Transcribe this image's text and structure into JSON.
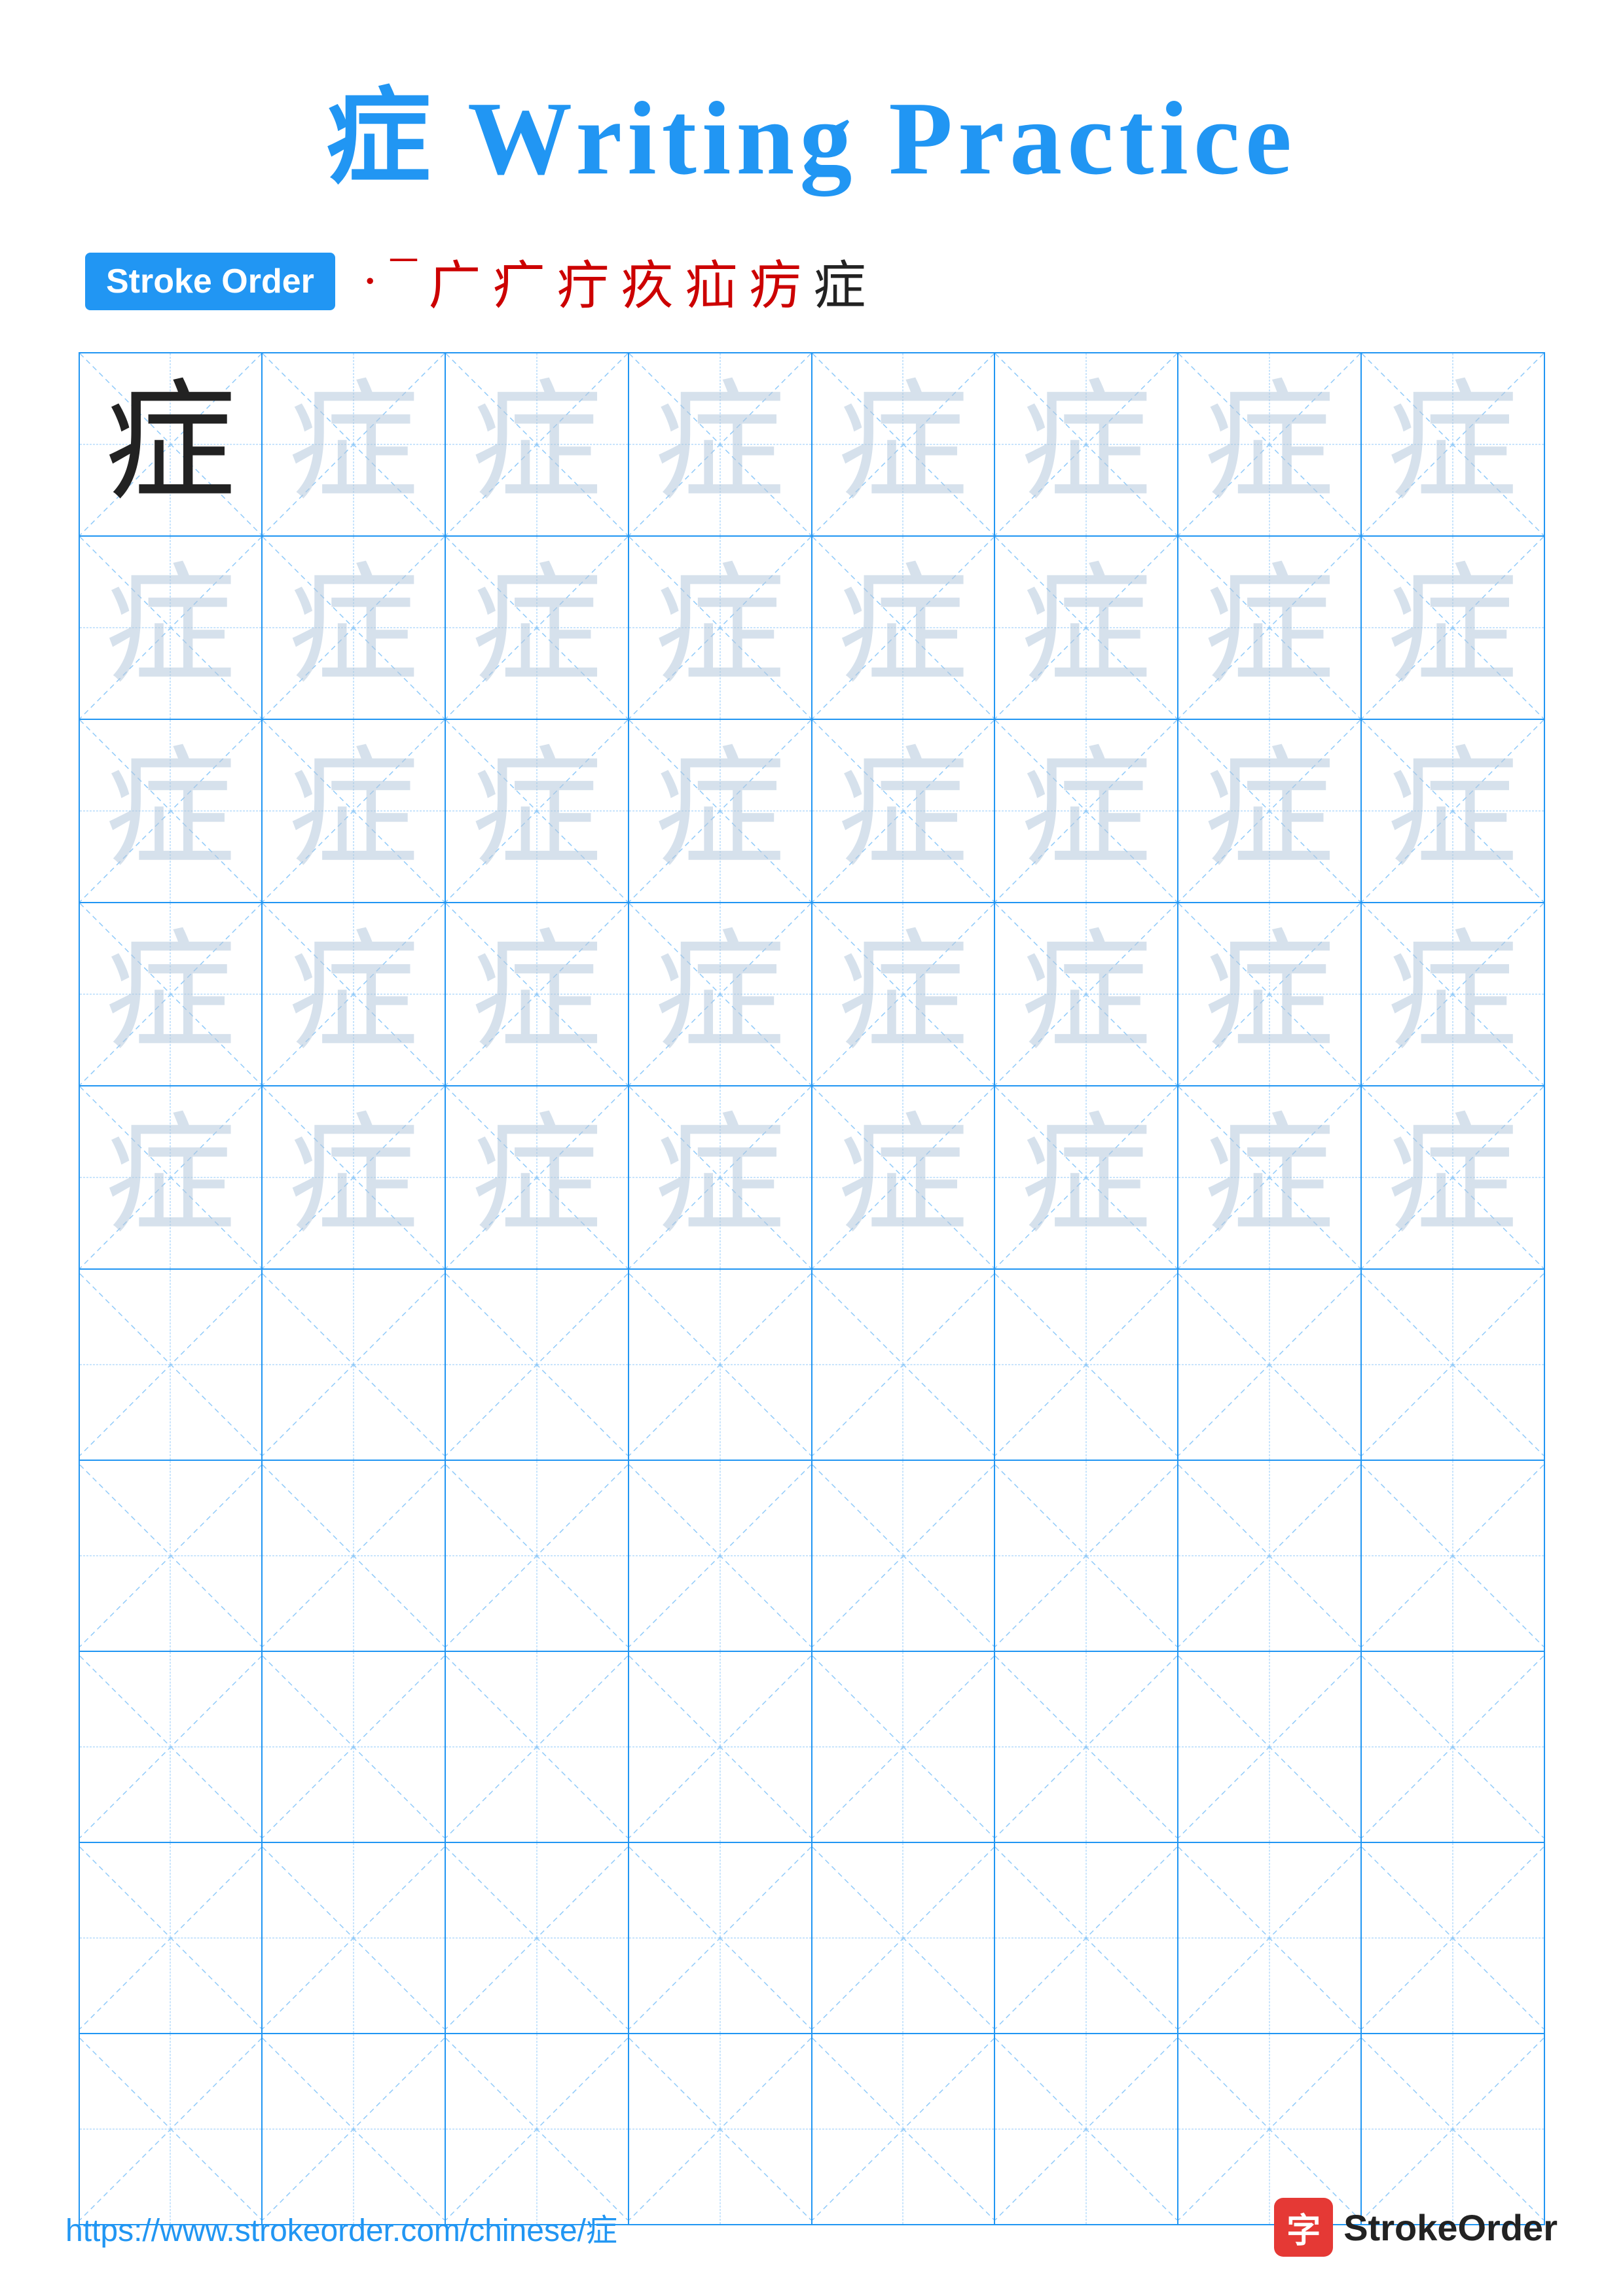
{
  "title": "症 Writing Practice",
  "stroke_order_badge": "Stroke Order",
  "stroke_sequence": [
    "·",
    "¯",
    "广",
    "疒",
    "疔",
    "疚",
    "疝",
    "疠",
    "症"
  ],
  "character": "症",
  "grid": {
    "rows": 10,
    "cols": 8,
    "faint_rows": 5,
    "model_cell": "症"
  },
  "footer": {
    "url": "https://www.strokeorder.com/chinese/症",
    "brand_icon": "字",
    "brand_name": "StrokeOrder"
  }
}
